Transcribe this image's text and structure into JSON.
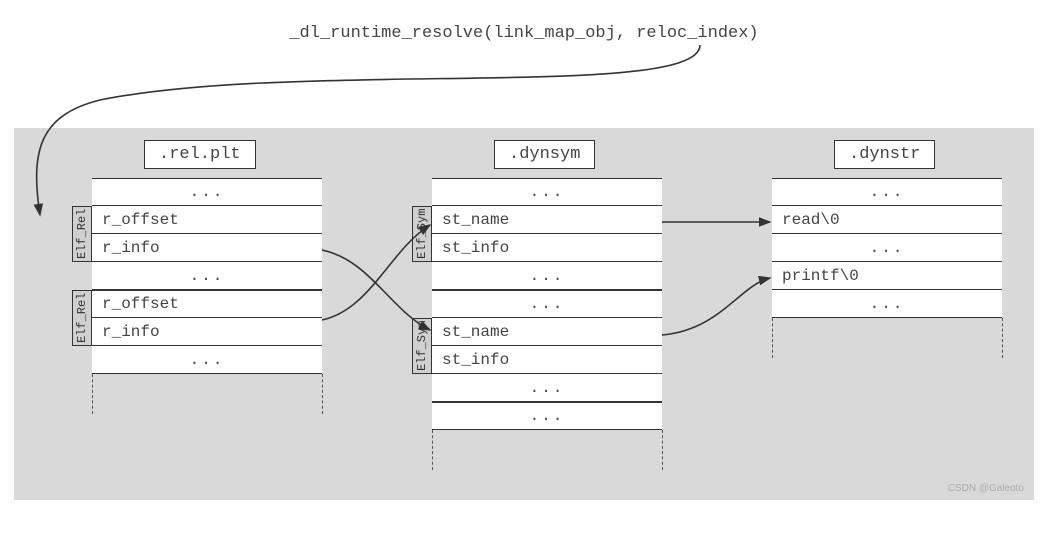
{
  "title": "_dl_runtime_resolve(link_map_obj, reloc_index)",
  "sections": {
    "relplt": {
      "title": ".rel.plt",
      "tag": "Elf_Rel",
      "rows1": [
        "...",
        "r_offset",
        "r_info",
        "..."
      ],
      "rows2": [
        "r_offset",
        "r_info",
        "..."
      ]
    },
    "dynsym": {
      "title": ".dynsym",
      "tag": "Elf_Sym",
      "rows1": [
        "...",
        "st_name",
        "st_info",
        "..."
      ],
      "rows2": [
        "...",
        "st_name",
        "st_info",
        "..."
      ],
      "rows3": [
        "..."
      ]
    },
    "dynstr": {
      "title": ".dynstr",
      "rows": [
        "...",
        "read\\0",
        "...",
        "printf\\0",
        "..."
      ]
    }
  },
  "watermark": "CSDN @Galeoto"
}
